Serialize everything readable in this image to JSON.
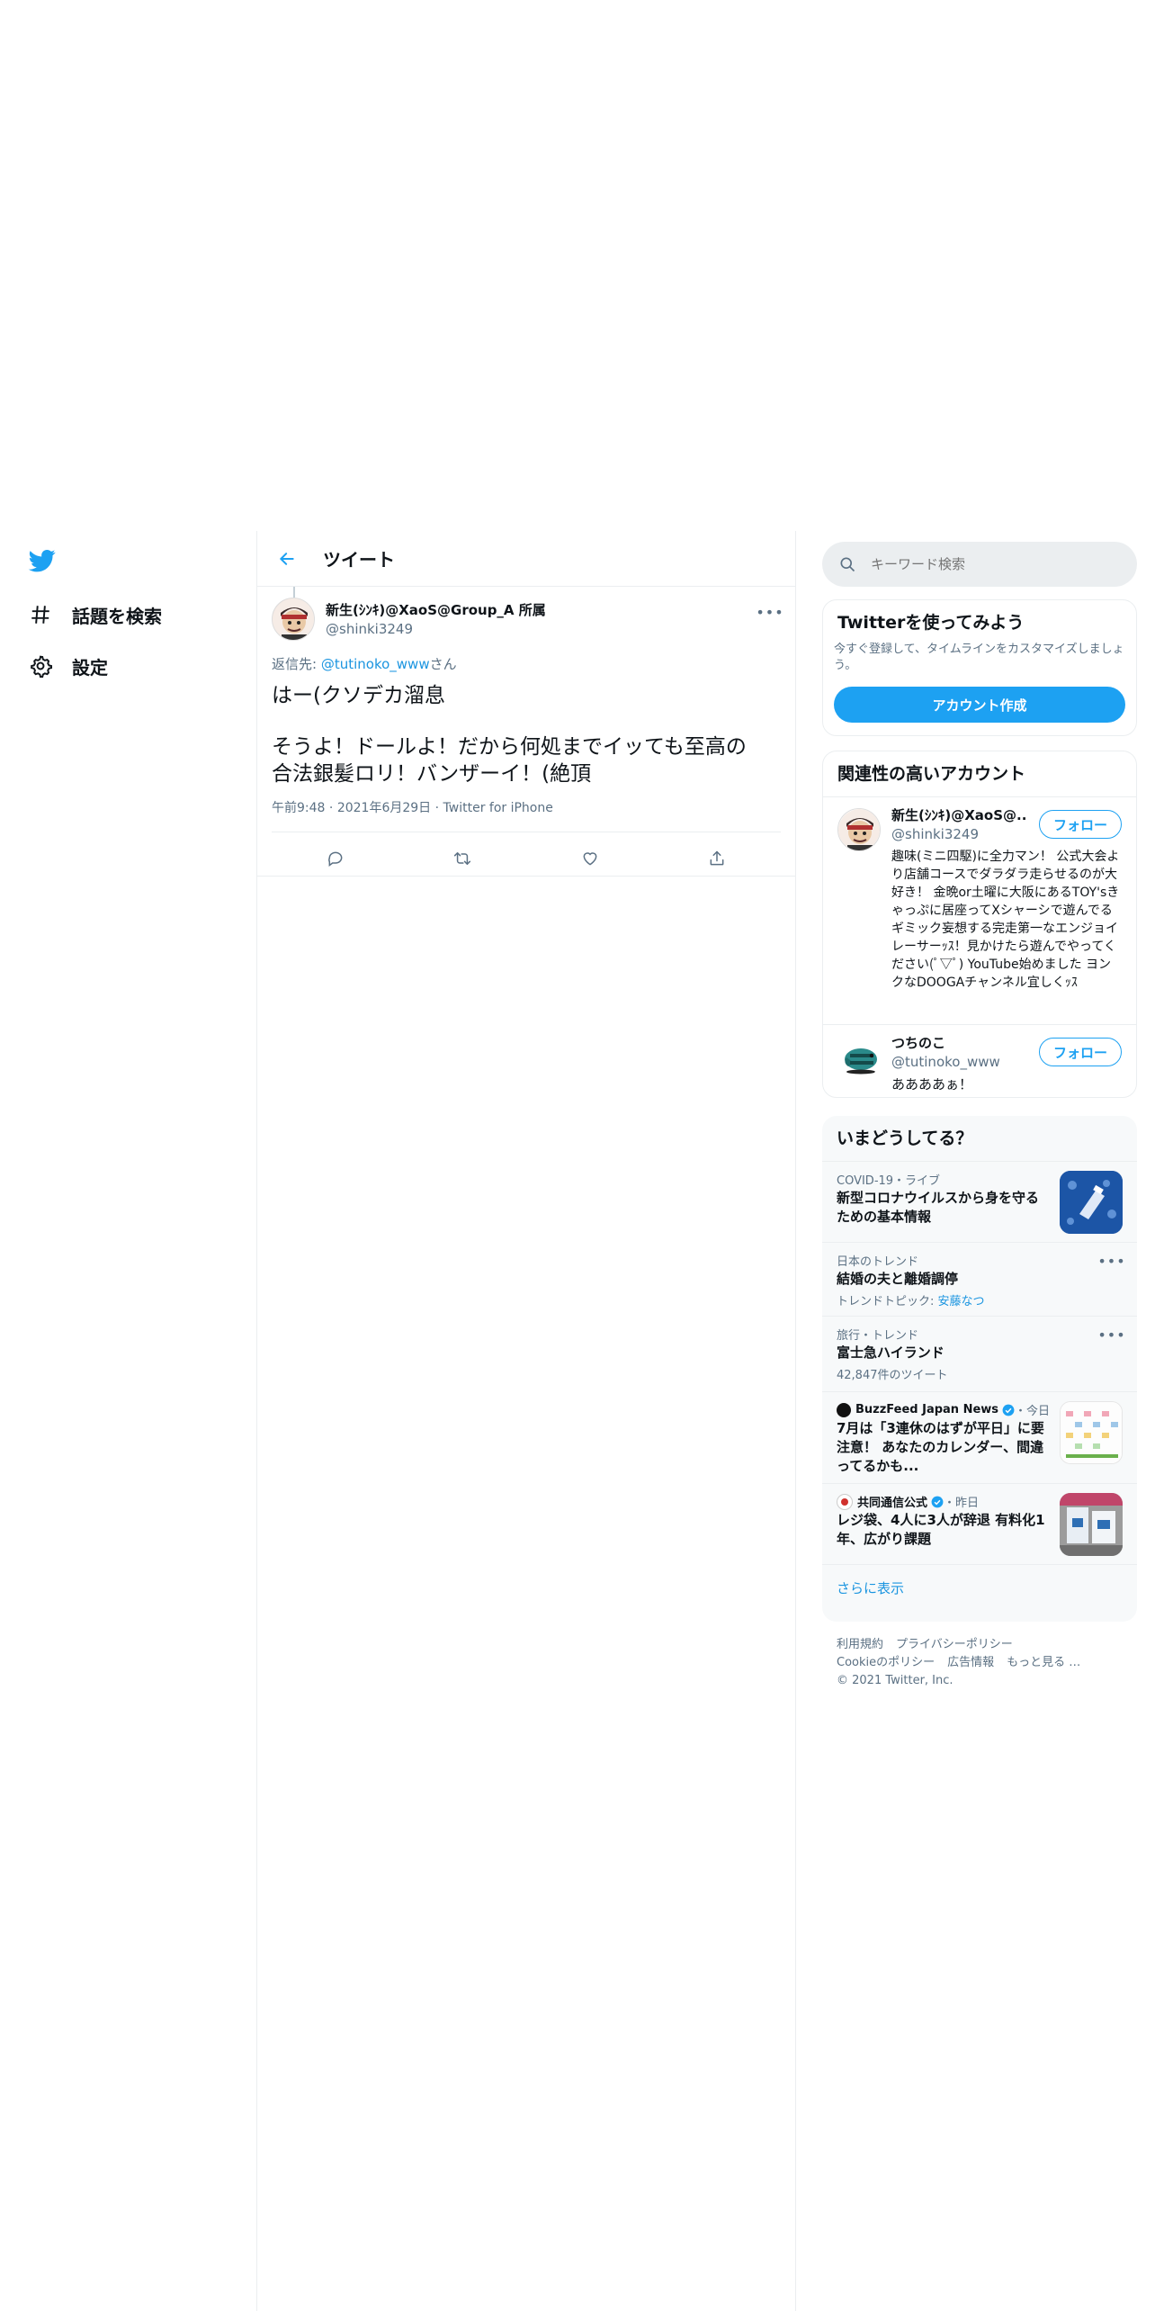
{
  "nav": {
    "items": [
      {
        "label": "話題を検索",
        "icon": "hashtag-icon"
      },
      {
        "label": "設定",
        "icon": "gear-icon"
      }
    ]
  },
  "header": {
    "title": "ツイート"
  },
  "tweet": {
    "author_name": "新生(ｼﾝｷ)@XaoS@Group_A 所属",
    "author_handle": "@shinki3249",
    "reply_prefix": "返信先: ",
    "reply_to": "@tutinoko_www",
    "reply_suffix": "さん",
    "text_line1": "はー(クソデカ溜息",
    "text_line2": "そうよ！ドールよ！だから何処までイッても至高の",
    "text_line3": "合法銀髪ロリ！バンザーイ！(絶頂",
    "meta_time": "午前9:48",
    "meta_sep1": " · ",
    "meta_date": "2021年6月29日",
    "meta_sep2": " · ",
    "meta_source": "Twitter for iPhone"
  },
  "search": {
    "placeholder": "キーワード検索"
  },
  "signup": {
    "title": "Twitterを使ってみよう",
    "desc": "今すぐ登録して、タイムラインをカスタマイズしましょう。",
    "button": "アカウント作成"
  },
  "related": {
    "title": "関連性の高いアカウント",
    "accounts": [
      {
        "name": "新生(ｼﾝｷ)@XaoS@...",
        "handle": "@shinki3249",
        "follow": "フォロー",
        "bio": "趣味(ミニ四駆)に全力マン！ 公式大会より店舗コースでダラダラ走らせるのが大好き！ 金晩or土曜に大阪にあるTOY'sきゃっぷに居座ってXシャーシで遊んでるギミック妄想する完走第一なエンジョイレーサーｯｽ！見かけたら遊んでやってください(ﾟ▽ﾟ) YouTube始めました ヨンクなDOOGAチャンネル宜しくｯｽ"
      },
      {
        "name": "つちのこ",
        "handle": "@tutinoko_www",
        "follow": "フォロー",
        "bio": "ああああぁ！"
      }
    ]
  },
  "trends": {
    "title": "いまどうしてる？",
    "items": [
      {
        "meta": "COVID-19・ライブ",
        "title1": "新型コロナウイルスから身を守る",
        "title2": "ための基本情報"
      },
      {
        "meta": "日本のトレンド",
        "title1": "結婚の夫と離婚調停",
        "topic_prefix": "トレンドトピック: ",
        "topic_link": "安藤なつ"
      },
      {
        "meta": "旅行・トレンド",
        "title1": "富士急ハイランド",
        "count": "42,847件のツイート"
      },
      {
        "source": "BuzzFeed Japan News",
        "time": "・今日",
        "title1": "7月は「3連休のはずが平日」に要",
        "title2": "注意！ あなたのカレンダー、間違",
        "title3": "ってるかも..."
      },
      {
        "source": "共同通信公式",
        "time": "・昨日",
        "title1": "レジ袋、4人に3人が辞退 有料化1",
        "title2": "年、広がり課題"
      }
    ],
    "show_more": "さらに表示"
  },
  "footer": {
    "links1": [
      "利用規約",
      "プライバシーポリシー"
    ],
    "links2": [
      "Cookieのポリシー",
      "広告情報",
      "もっと見る …"
    ],
    "copyright": "© 2021 Twitter, Inc."
  },
  "colors": {
    "accent": "#1da1f2",
    "link": "#1b95e0",
    "muted": "#5b7083",
    "panel": "#f7f9fa",
    "border": "#ebeef0"
  }
}
